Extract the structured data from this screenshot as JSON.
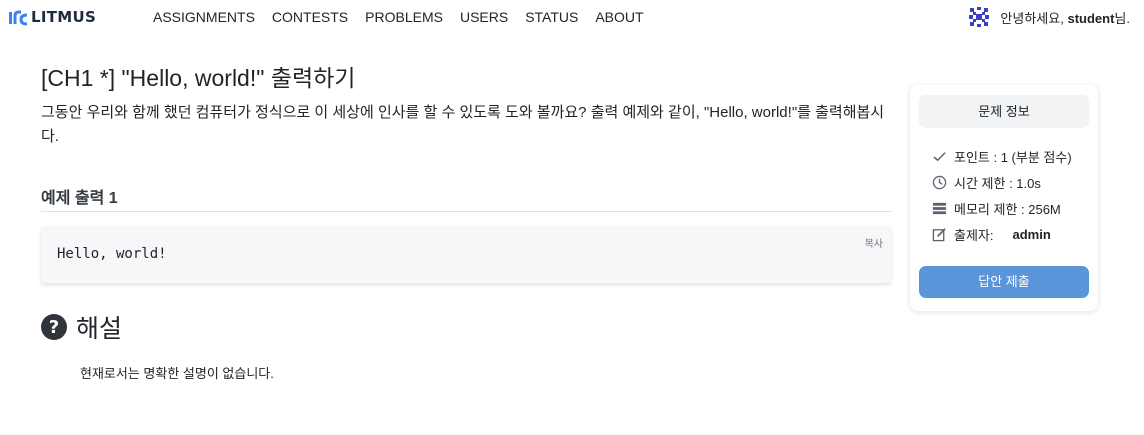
{
  "brand": {
    "name": "LITMUS",
    "logo_icon": "litmus-logo-icon",
    "accent": "#3b82f6"
  },
  "nav": {
    "items": [
      "ASSIGNMENTS",
      "CONTESTS",
      "PROBLEMS",
      "USERS",
      "STATUS",
      "ABOUT"
    ]
  },
  "user": {
    "greeting_prefix": "안녕하세요,",
    "username": "student",
    "greeting_suffix": "님.",
    "avatar_icon": "identicon-avatar"
  },
  "problem": {
    "title": "[CH1 *] \"Hello, world!\" 출력하기",
    "description": "그동안 우리와 함께 했던 컴퓨터가 정식으로 이 세상에 인사를 할 수 있도록 도와 볼까요? 출력 예제와 같이, \"Hello, world!\"를 출력해봅시다."
  },
  "sample": {
    "title": "예제 출력 1",
    "output": "Hello, world!",
    "copy_label": "복사"
  },
  "hint": {
    "icon": "question-circle-icon",
    "title": "해설",
    "text": "현재로서는 명확한 설명이 없습니다."
  },
  "info": {
    "title": "문제 정보",
    "points": "포인트 : 1 (부분 점수)",
    "time_limit": "시간 제한 : 1.0s",
    "memory_limit": "메모리 제한 : 256M",
    "author_label": "출제자:",
    "author": "admin",
    "submit_label": "답안 제출",
    "submit_color": "#5b95d9"
  }
}
